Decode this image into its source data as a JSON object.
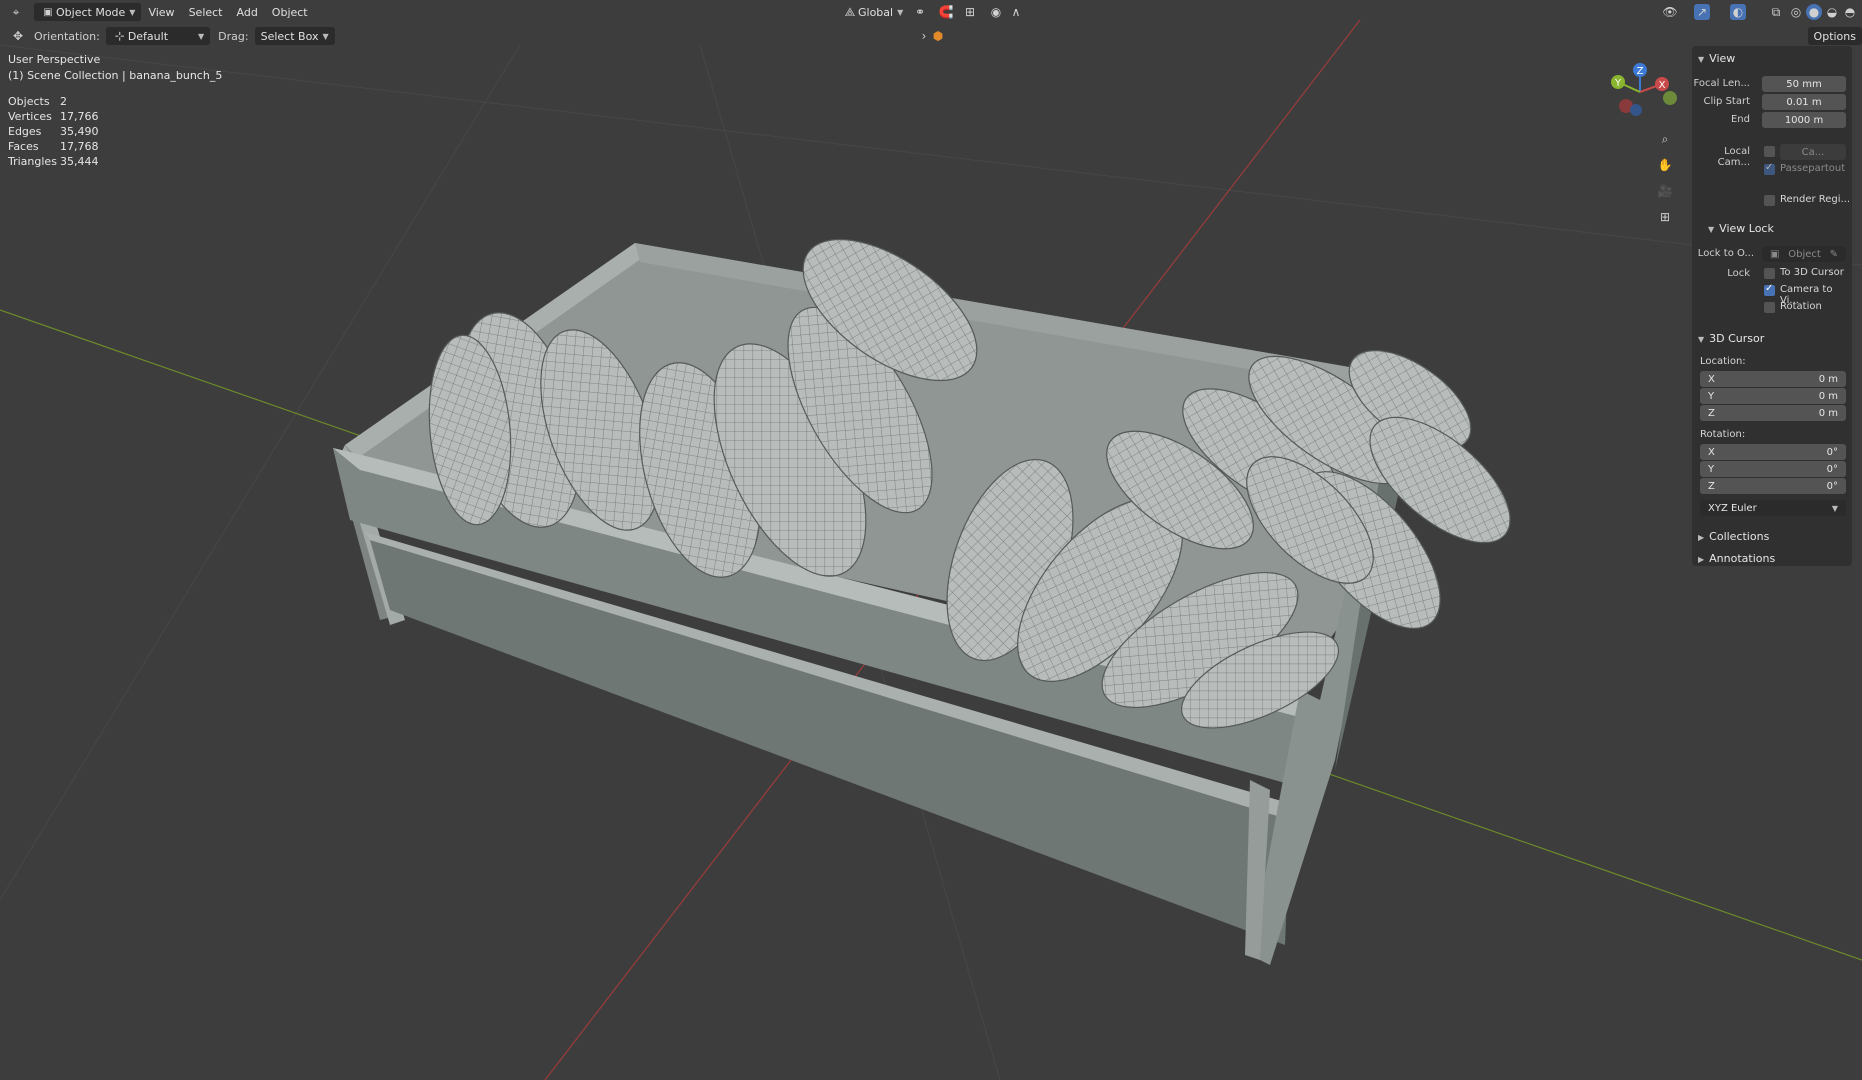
{
  "header": {
    "mode": "Object Mode",
    "menus": [
      "View",
      "Select",
      "Add",
      "Object"
    ],
    "transform_orientation": "Global",
    "options_label": "Options"
  },
  "tool_header": {
    "orientation_label": "Orientation:",
    "orientation_value": "Default",
    "drag_label": "Drag:",
    "drag_value": "Select Box"
  },
  "overlay": {
    "perspective": "User Perspective",
    "collection": "(1) Scene Collection | banana_bunch_5",
    "stats": [
      {
        "key": "Objects",
        "value": "2"
      },
      {
        "key": "Vertices",
        "value": "17,766"
      },
      {
        "key": "Edges",
        "value": "35,490"
      },
      {
        "key": "Faces",
        "value": "17,768"
      },
      {
        "key": "Triangles",
        "value": "35,444"
      }
    ]
  },
  "gizmo": {
    "x": "X",
    "y": "Y",
    "z": "Z"
  },
  "npanel": {
    "view": {
      "title": "View",
      "focal_label": "Focal Len...",
      "focal_value": "50 mm",
      "clip_start_label": "Clip Start",
      "clip_start_value": "0.01 m",
      "clip_end_label": "End",
      "clip_end_value": "1000 m",
      "local_cam_label": "Local Cam...",
      "local_cam_value": "Ca...",
      "passepartout_label": "Passepartout",
      "render_region_label": "Render Regi..."
    },
    "view_lock": {
      "title": "View Lock",
      "lock_to_label": "Lock to O...",
      "lock_to_placeholder": "Object",
      "lock_label": "Lock",
      "to_cursor_label": "To 3D Cursor",
      "camera_to_view_label": "Camera to Vi...",
      "rotation_label": "Rotation"
    },
    "cursor": {
      "title": "3D Cursor",
      "location_label": "Location:",
      "loc": [
        {
          "axis": "X",
          "value": "0 m"
        },
        {
          "axis": "Y",
          "value": "0 m"
        },
        {
          "axis": "Z",
          "value": "0 m"
        }
      ],
      "rotation_label": "Rotation:",
      "rot": [
        {
          "axis": "X",
          "value": "0°"
        },
        {
          "axis": "Y",
          "value": "0°"
        },
        {
          "axis": "Z",
          "value": "0°"
        }
      ],
      "rotation_mode": "XYZ Euler"
    },
    "collections_title": "Collections",
    "annotations_title": "Annotations"
  },
  "colors": {
    "viewport_bg": "#3d3d3d",
    "x_axis": "#9c3b3b",
    "y_axis": "#6b8a2a",
    "accent": "#4772b3"
  }
}
